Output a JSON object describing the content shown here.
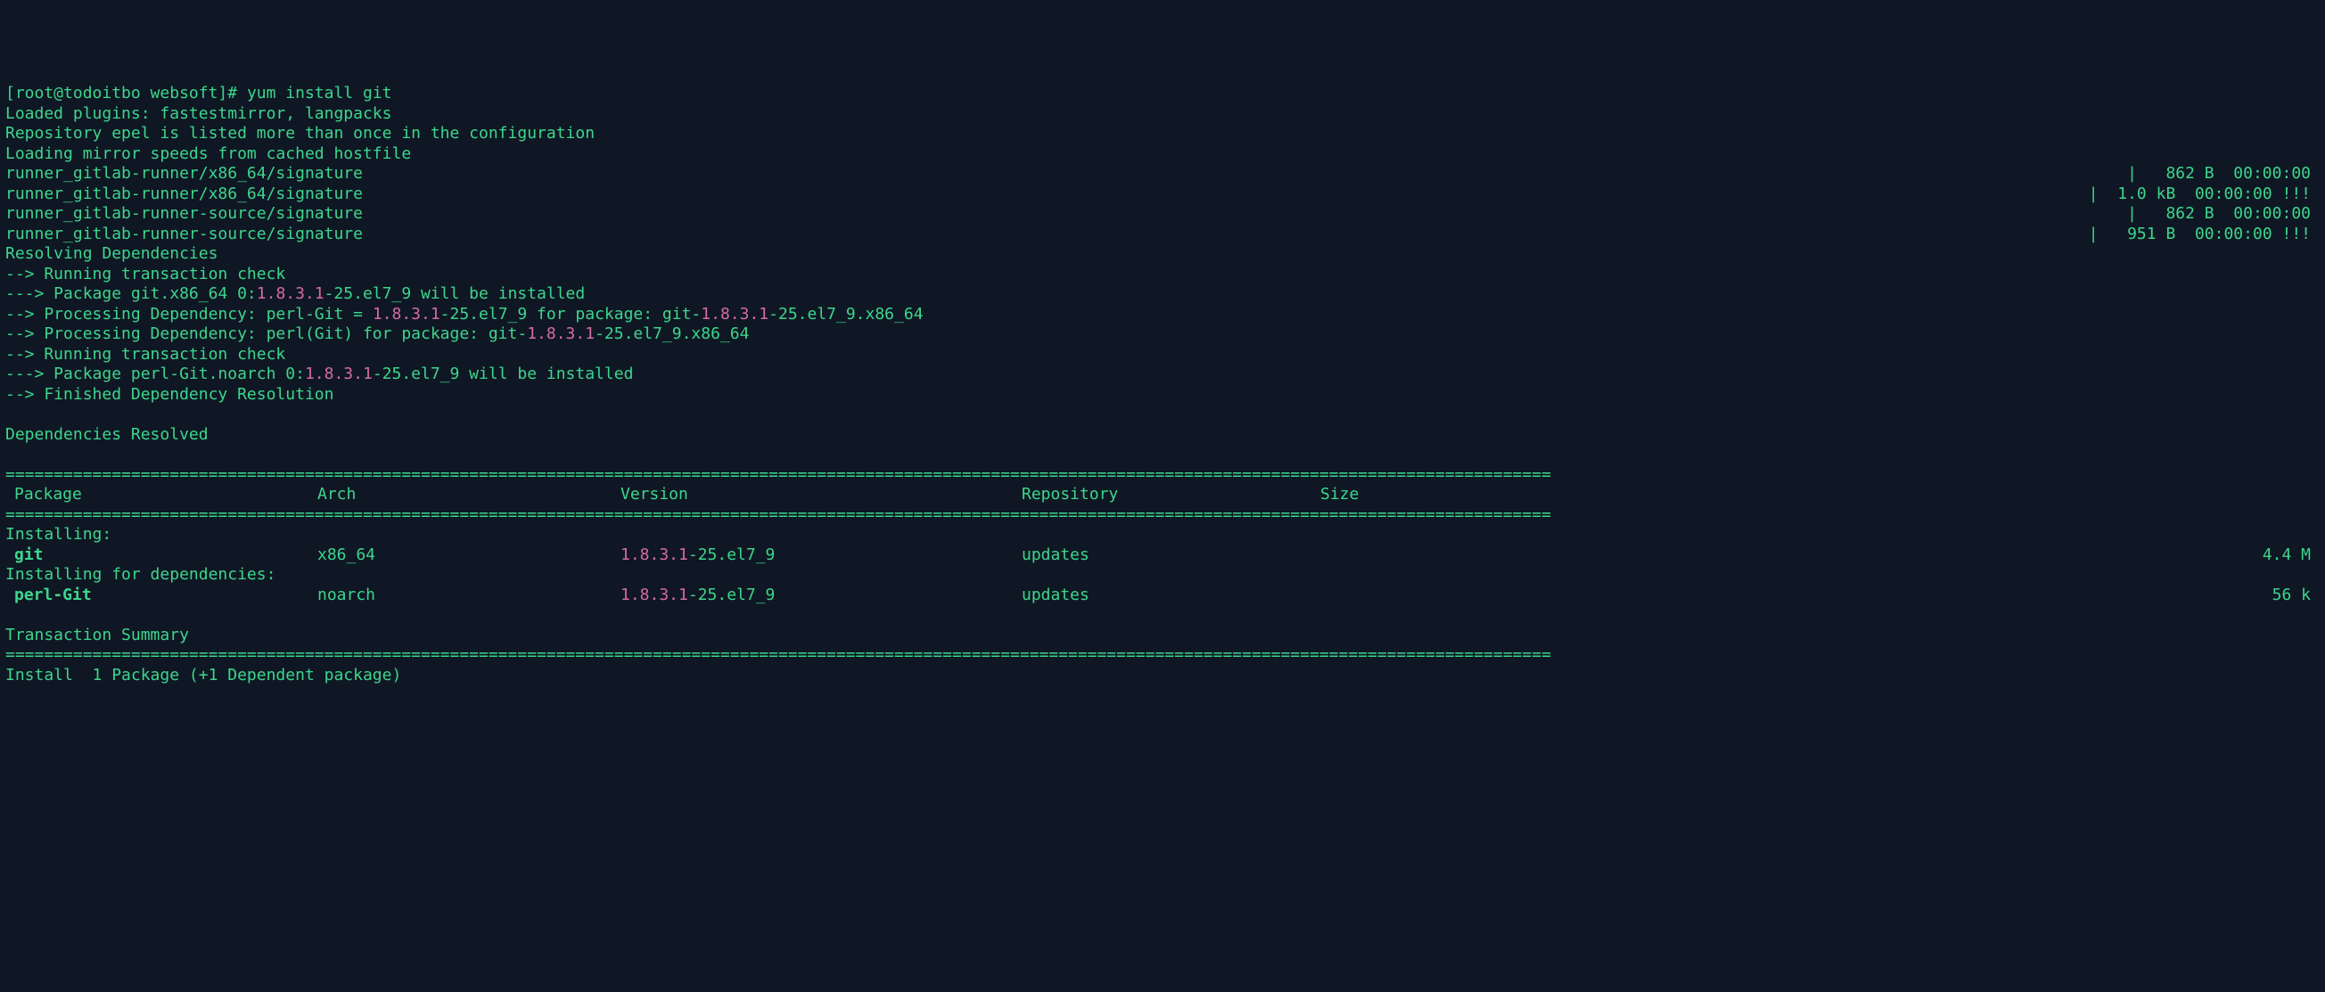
{
  "prompt": "[root@todoitbo websoft]# ",
  "command": "yum install git",
  "pre_lines": [
    "Loaded plugins: fastestmirror, langpacks",
    "Repository epel is listed more than once in the configuration",
    "Loading mirror speeds from cached hostfile"
  ],
  "mirrors": [
    {
      "name": "runner_gitlab-runner/x86_64/signature",
      "size": "862 B",
      "time": "00:00:00",
      "bang": ""
    },
    {
      "name": "runner_gitlab-runner/x86_64/signature",
      "size": "1.0 kB",
      "time": "00:00:00",
      "bang": " !!!"
    },
    {
      "name": "runner_gitlab-runner-source/signature",
      "size": "862 B",
      "time": "00:00:00",
      "bang": ""
    },
    {
      "name": "runner_gitlab-runner-source/signature",
      "size": "951 B",
      "time": "00:00:00",
      "bang": " !!!"
    }
  ],
  "resolve_header": "Resolving Dependencies",
  "dep_lines": [
    {
      "segs": [
        {
          "t": "--> Running transaction check"
        }
      ]
    },
    {
      "segs": [
        {
          "t": "---> Package git.x86_64 0:"
        },
        {
          "t": "1.8.3.1",
          "c": "mag"
        },
        {
          "t": "-25.el7_9 will be installed"
        }
      ]
    },
    {
      "segs": [
        {
          "t": "--> Processing Dependency: perl-Git = "
        },
        {
          "t": "1.8.3.1",
          "c": "mag"
        },
        {
          "t": "-25.el7_9 for package: git-"
        },
        {
          "t": "1.8.3.1",
          "c": "mag"
        },
        {
          "t": "-25.el7_9.x86_64"
        }
      ]
    },
    {
      "segs": [
        {
          "t": "--> Processing Dependency: perl(Git) for package: git-"
        },
        {
          "t": "1.8.3.1",
          "c": "mag"
        },
        {
          "t": "-25.el7_9.x86_64"
        }
      ]
    },
    {
      "segs": [
        {
          "t": "--> Running transaction check"
        }
      ]
    },
    {
      "segs": [
        {
          "t": "---> Package perl-Git.noarch 0:"
        },
        {
          "t": "1.8.3.1",
          "c": "mag"
        },
        {
          "t": "-25.el7_9 will be installed"
        }
      ]
    },
    {
      "segs": [
        {
          "t": "--> Finished Dependency Resolution"
        }
      ]
    }
  ],
  "deps_resolved": "Dependencies Resolved",
  "sep_char": "=",
  "table": {
    "headers": {
      "pkg": "Package",
      "arch": "Arch",
      "ver": "Version",
      "repo": "Repository",
      "size": "Size"
    },
    "groups": [
      {
        "title": "Installing:",
        "rows": [
          {
            "pkg": "git",
            "arch": "x86_64",
            "ver_a": "1.8.3.1",
            "ver_b": "-25.el7_9",
            "repo": "updates",
            "size": "4.4 M"
          }
        ]
      },
      {
        "title": "Installing for dependencies:",
        "rows": [
          {
            "pkg": "perl-Git",
            "arch": "noarch",
            "ver_a": "1.8.3.1",
            "ver_b": "-25.el7_9",
            "repo": "updates",
            "size": "56 k"
          }
        ]
      }
    ]
  },
  "txn_summary": "Transaction Summary",
  "install_line": "Install  1 Package (+1 Dependent package)"
}
